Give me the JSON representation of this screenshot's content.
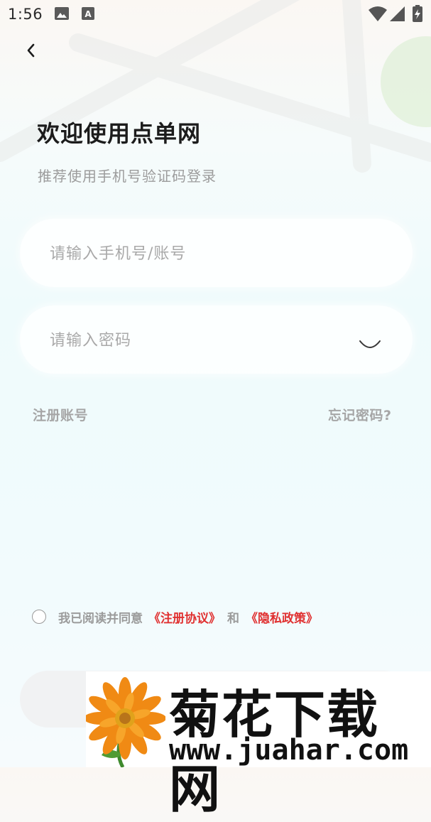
{
  "status_bar": {
    "time": "1:56",
    "icons": [
      "image-icon",
      "font-a-icon",
      "wifi-icon",
      "signal-icon",
      "battery-charging-icon"
    ]
  },
  "header": {
    "back_icon": "chevron-left-icon",
    "title": "欢迎使用点单网",
    "subtitle": "推荐使用手机号验证码登录"
  },
  "form": {
    "account_placeholder": "请输入手机号/账号",
    "account_value": "",
    "password_placeholder": "请输入密码",
    "password_value": "",
    "eye_icon": "eye-closed-icon"
  },
  "links": {
    "register": "注册账号",
    "forgot": "忘记密码?"
  },
  "agreement": {
    "checked": false,
    "prefix": "我已阅读并同意",
    "terms": "《注册协议》",
    "and": "和",
    "privacy": "《隐私政策》"
  },
  "watermark": {
    "title": "菊花下载网",
    "url": "www.juahar.com"
  },
  "colors": {
    "accent_red": "#e03131",
    "muted_text": "#9b9b9b",
    "title_text": "#1c1c1c"
  }
}
